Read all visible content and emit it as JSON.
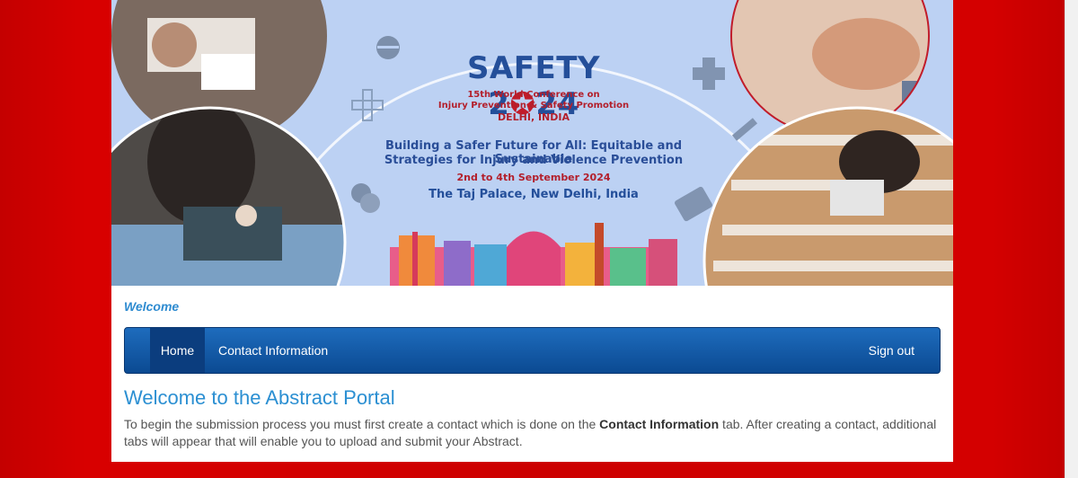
{
  "banner": {
    "title_prefix": "SAFETY 2",
    "title_star": "✪",
    "title_suffix": "24",
    "subtitle_line1": "15th World Conference on",
    "subtitle_line2": "Injury Prevention & Safety Promotion",
    "subtitle_line3": "DELHI, INDIA",
    "tagline_line1": "Building a Safer Future for All: Equitable and Sustainable",
    "tagline_line2": "Strategies for Injury and Violence Prevention",
    "dates": "2nd to 4th September 2024",
    "venue": "The Taj Palace, New Delhi, India"
  },
  "welcome_label": "Welcome",
  "nav": {
    "home": "Home",
    "contact": "Contact Information",
    "signout": "Sign out"
  },
  "main": {
    "heading": "Welcome to the Abstract Portal",
    "intro_before": "To begin the submission process you must first create a contact which is done on the ",
    "intro_bold": "Contact Information",
    "intro_after": " tab. After creating a contact, additional tabs will appear that will enable you to upload and submit your Abstract."
  },
  "colors": {
    "background": "#cc0000",
    "banner_bg": "#bcd1f3",
    "navbar": "#0b4a92",
    "heading": "#2b8fd2"
  }
}
